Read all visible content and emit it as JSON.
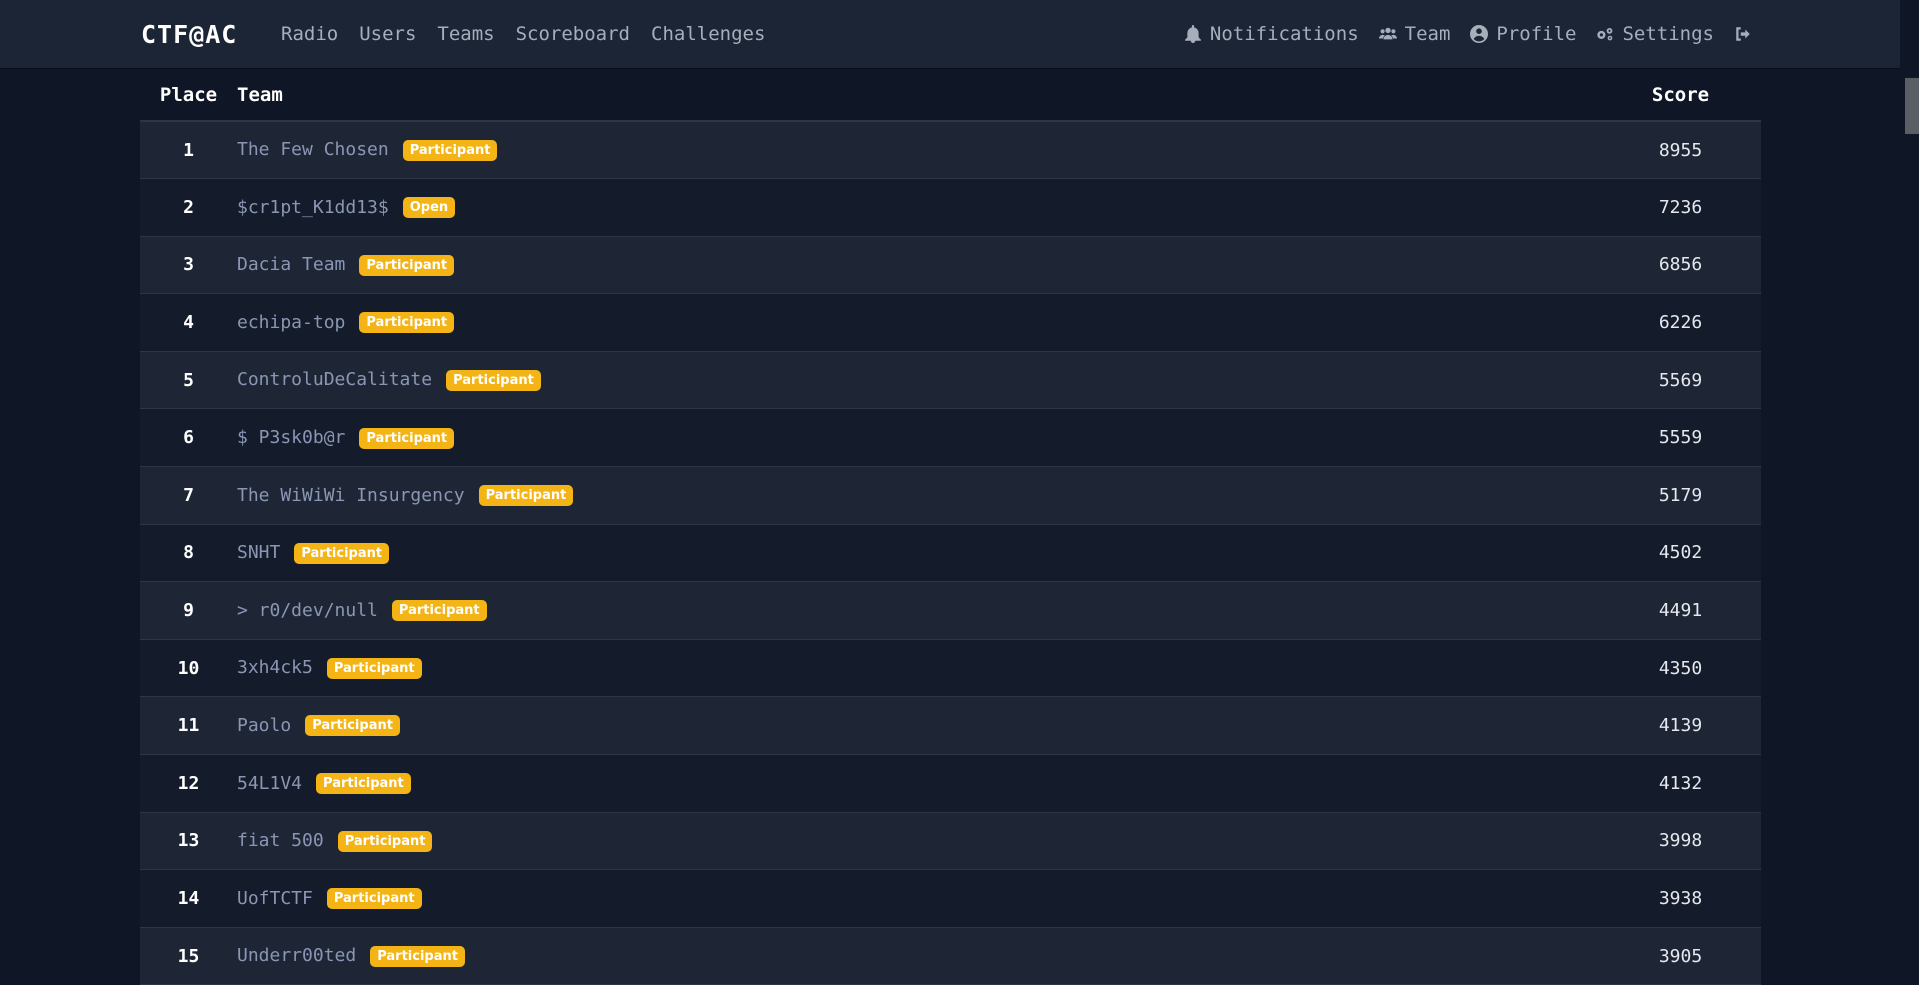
{
  "navbar": {
    "brand": "CTF@AC",
    "left_links": [
      "Radio",
      "Users",
      "Teams",
      "Scoreboard",
      "Challenges"
    ],
    "right_links": [
      {
        "label": "Notifications",
        "icon": "bell-icon"
      },
      {
        "label": "Team",
        "icon": "users-icon"
      },
      {
        "label": "Profile",
        "icon": "user-circle-icon"
      },
      {
        "label": "Settings",
        "icon": "gears-icon"
      }
    ],
    "logout_icon": "logout-icon"
  },
  "table": {
    "headers": {
      "place": "Place",
      "team": "Team",
      "score": "Score"
    },
    "rows": [
      {
        "place": "1",
        "team": "The Few Chosen",
        "badge": "Participant",
        "score": "8955"
      },
      {
        "place": "2",
        "team": "$cr1pt_K1dd13$",
        "badge": "Open",
        "score": "7236"
      },
      {
        "place": "3",
        "team": "Dacia Team",
        "badge": "Participant",
        "score": "6856"
      },
      {
        "place": "4",
        "team": "echipa-top",
        "badge": "Participant",
        "score": "6226"
      },
      {
        "place": "5",
        "team": "ControluDeCalitate",
        "badge": "Participant",
        "score": "5569"
      },
      {
        "place": "6",
        "team": "$ P3sk0b@r",
        "badge": "Participant",
        "score": "5559"
      },
      {
        "place": "7",
        "team": "The WiWiWi Insurgency",
        "badge": "Participant",
        "score": "5179"
      },
      {
        "place": "8",
        "team": "SNHT",
        "badge": "Participant",
        "score": "4502"
      },
      {
        "place": "9",
        "team": "> r0/dev/null",
        "badge": "Participant",
        "score": "4491"
      },
      {
        "place": "10",
        "team": "3xh4ck5",
        "badge": "Participant",
        "score": "4350"
      },
      {
        "place": "11",
        "team": "Paolo",
        "badge": "Participant",
        "score": "4139"
      },
      {
        "place": "12",
        "team": "54L1V4",
        "badge": "Participant",
        "score": "4132"
      },
      {
        "place": "13",
        "team": "fiat 500",
        "badge": "Participant",
        "score": "3998"
      },
      {
        "place": "14",
        "team": "UofTCTF",
        "badge": "Participant",
        "score": "3938"
      },
      {
        "place": "15",
        "team": "Underr00ted",
        "badge": "Participant",
        "score": "3905"
      }
    ]
  },
  "colors": {
    "background": "#0f1626",
    "navbar": "#1c2535",
    "badge": "#f5b415",
    "team_link": "#8a96b4"
  }
}
